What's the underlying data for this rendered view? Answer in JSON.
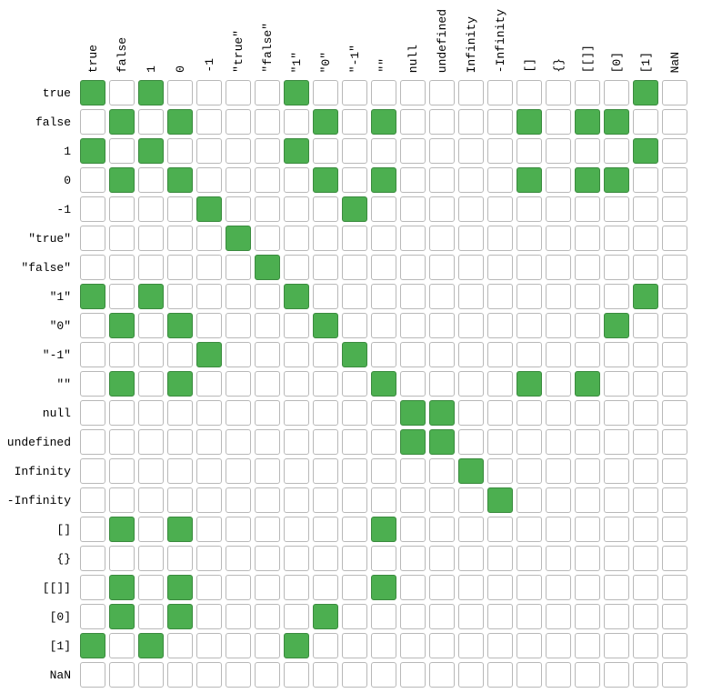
{
  "chart_data": {
    "type": "heatmap",
    "title": "",
    "xlabel": "",
    "ylabel": "",
    "categories": [
      "true",
      "false",
      "1",
      "0",
      "-1",
      "\"true\"",
      "\"false\"",
      "\"1\"",
      "\"0\"",
      "\"-1\"",
      "\"\"",
      "null",
      "undefined",
      "Infinity",
      "-Infinity",
      "[]",
      "{}",
      "[[]]",
      "[0]",
      "[1]",
      "NaN"
    ],
    "series": [
      {
        "name": "true",
        "values": [
          1,
          0,
          1,
          0,
          0,
          0,
          0,
          1,
          0,
          0,
          0,
          0,
          0,
          0,
          0,
          0,
          0,
          0,
          0,
          1,
          0
        ]
      },
      {
        "name": "false",
        "values": [
          0,
          1,
          0,
          1,
          0,
          0,
          0,
          0,
          1,
          0,
          1,
          0,
          0,
          0,
          0,
          1,
          0,
          1,
          1,
          0,
          0
        ]
      },
      {
        "name": "1",
        "values": [
          1,
          0,
          1,
          0,
          0,
          0,
          0,
          1,
          0,
          0,
          0,
          0,
          0,
          0,
          0,
          0,
          0,
          0,
          0,
          1,
          0
        ]
      },
      {
        "name": "0",
        "values": [
          0,
          1,
          0,
          1,
          0,
          0,
          0,
          0,
          1,
          0,
          1,
          0,
          0,
          0,
          0,
          1,
          0,
          1,
          1,
          0,
          0
        ]
      },
      {
        "name": "-1",
        "values": [
          0,
          0,
          0,
          0,
          1,
          0,
          0,
          0,
          0,
          1,
          0,
          0,
          0,
          0,
          0,
          0,
          0,
          0,
          0,
          0,
          0
        ]
      },
      {
        "name": "\"true\"",
        "values": [
          0,
          0,
          0,
          0,
          0,
          1,
          0,
          0,
          0,
          0,
          0,
          0,
          0,
          0,
          0,
          0,
          0,
          0,
          0,
          0,
          0
        ]
      },
      {
        "name": "\"false\"",
        "values": [
          0,
          0,
          0,
          0,
          0,
          0,
          1,
          0,
          0,
          0,
          0,
          0,
          0,
          0,
          0,
          0,
          0,
          0,
          0,
          0,
          0
        ]
      },
      {
        "name": "\"1\"",
        "values": [
          1,
          0,
          1,
          0,
          0,
          0,
          0,
          1,
          0,
          0,
          0,
          0,
          0,
          0,
          0,
          0,
          0,
          0,
          0,
          1,
          0
        ]
      },
      {
        "name": "\"0\"",
        "values": [
          0,
          1,
          0,
          1,
          0,
          0,
          0,
          0,
          1,
          0,
          0,
          0,
          0,
          0,
          0,
          0,
          0,
          0,
          1,
          0,
          0
        ]
      },
      {
        "name": "\"-1\"",
        "values": [
          0,
          0,
          0,
          0,
          1,
          0,
          0,
          0,
          0,
          1,
          0,
          0,
          0,
          0,
          0,
          0,
          0,
          0,
          0,
          0,
          0
        ]
      },
      {
        "name": "\"\"",
        "values": [
          0,
          1,
          0,
          1,
          0,
          0,
          0,
          0,
          0,
          0,
          1,
          0,
          0,
          0,
          0,
          1,
          0,
          1,
          0,
          0,
          0
        ]
      },
      {
        "name": "null",
        "values": [
          0,
          0,
          0,
          0,
          0,
          0,
          0,
          0,
          0,
          0,
          0,
          1,
          1,
          0,
          0,
          0,
          0,
          0,
          0,
          0,
          0
        ]
      },
      {
        "name": "undefined",
        "values": [
          0,
          0,
          0,
          0,
          0,
          0,
          0,
          0,
          0,
          0,
          0,
          1,
          1,
          0,
          0,
          0,
          0,
          0,
          0,
          0,
          0
        ]
      },
      {
        "name": "Infinity",
        "values": [
          0,
          0,
          0,
          0,
          0,
          0,
          0,
          0,
          0,
          0,
          0,
          0,
          0,
          1,
          0,
          0,
          0,
          0,
          0,
          0,
          0
        ]
      },
      {
        "name": "-Infinity",
        "values": [
          0,
          0,
          0,
          0,
          0,
          0,
          0,
          0,
          0,
          0,
          0,
          0,
          0,
          0,
          1,
          0,
          0,
          0,
          0,
          0,
          0
        ]
      },
      {
        "name": "[]",
        "values": [
          0,
          1,
          0,
          1,
          0,
          0,
          0,
          0,
          0,
          0,
          1,
          0,
          0,
          0,
          0,
          0,
          0,
          0,
          0,
          0,
          0
        ]
      },
      {
        "name": "{}",
        "values": [
          0,
          0,
          0,
          0,
          0,
          0,
          0,
          0,
          0,
          0,
          0,
          0,
          0,
          0,
          0,
          0,
          0,
          0,
          0,
          0,
          0
        ]
      },
      {
        "name": "[[]]",
        "values": [
          0,
          1,
          0,
          1,
          0,
          0,
          0,
          0,
          0,
          0,
          1,
          0,
          0,
          0,
          0,
          0,
          0,
          0,
          0,
          0,
          0
        ]
      },
      {
        "name": "[0]",
        "values": [
          0,
          1,
          0,
          1,
          0,
          0,
          0,
          0,
          1,
          0,
          0,
          0,
          0,
          0,
          0,
          0,
          0,
          0,
          0,
          0,
          0
        ]
      },
      {
        "name": "[1]",
        "values": [
          1,
          0,
          1,
          0,
          0,
          0,
          0,
          1,
          0,
          0,
          0,
          0,
          0,
          0,
          0,
          0,
          0,
          0,
          0,
          0,
          0
        ]
      },
      {
        "name": "NaN",
        "values": [
          0,
          0,
          0,
          0,
          0,
          0,
          0,
          0,
          0,
          0,
          0,
          0,
          0,
          0,
          0,
          0,
          0,
          0,
          0,
          0,
          0
        ]
      }
    ],
    "colors": {
      "on": "#4caf50",
      "off": "#ffffff"
    }
  }
}
